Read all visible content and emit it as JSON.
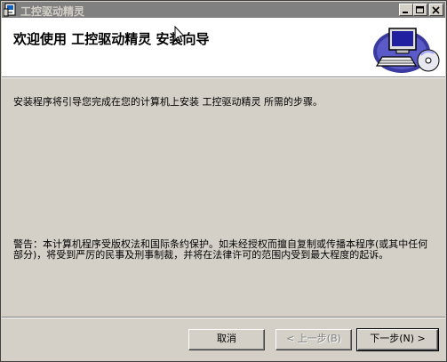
{
  "window": {
    "title": "工控驱动精灵"
  },
  "titlebar_buttons": {
    "minimize_icon": "minimize-icon",
    "maximize_icon": "maximize-icon",
    "close_icon": "close-icon"
  },
  "header": {
    "title": "欢迎使用  工控驱动精灵 安装向导",
    "art_icon": "computer-cd-icon"
  },
  "body": {
    "intro": "安装程序将引导您完成在您的计算机上安装 工控驱动精灵 所需的步骤。",
    "warning": "警告：本计算机程序受版权法和国际条约保护。如未经授权而擅自复制或传播本程序(或其中任何部分)，将受到严厉的民事及刑事制裁，并将在法律许可的范围内受到最大程度的起诉。"
  },
  "footer": {
    "cancel_label": "取消",
    "back_label": "< 上一步(B)",
    "next_label": "下一步(N) >"
  },
  "colors": {
    "titlebar_inactive": "#808080",
    "dialog_face": "#d4d0c8",
    "header_bg": "#ffffff"
  }
}
